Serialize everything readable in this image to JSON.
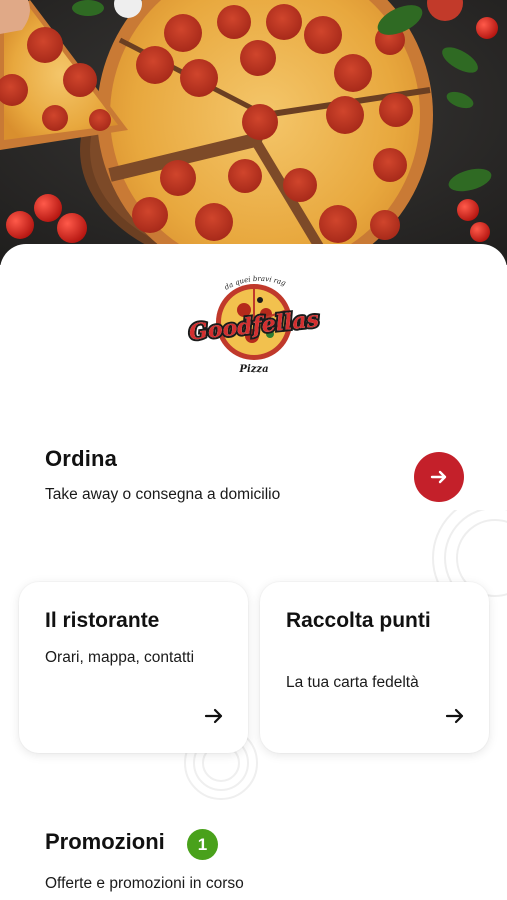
{
  "hero": {
    "image": "pepperoni-pizza-photo"
  },
  "logo": {
    "brand": "Goodfellas",
    "tagline": "da quei bravi ragazzi",
    "subtitle": "Pizza"
  },
  "ordina": {
    "title": "Ordina",
    "subtitle": "Take away o consegna a domicilio",
    "button_icon": "arrow-right-icon",
    "button_color": "#c4202a"
  },
  "cards": [
    {
      "title": "Il ristorante",
      "subtitle": "Orari, mappa, contatti",
      "icon": "arrow-right-icon"
    },
    {
      "title": "Raccolta punti",
      "subtitle": "La tua carta fedeltà",
      "icon": "arrow-right-icon"
    }
  ],
  "promozioni": {
    "title": "Promozioni",
    "badge": "1",
    "badge_color": "#49a11b",
    "subtitle": "Offerte e promozioni in corso"
  }
}
